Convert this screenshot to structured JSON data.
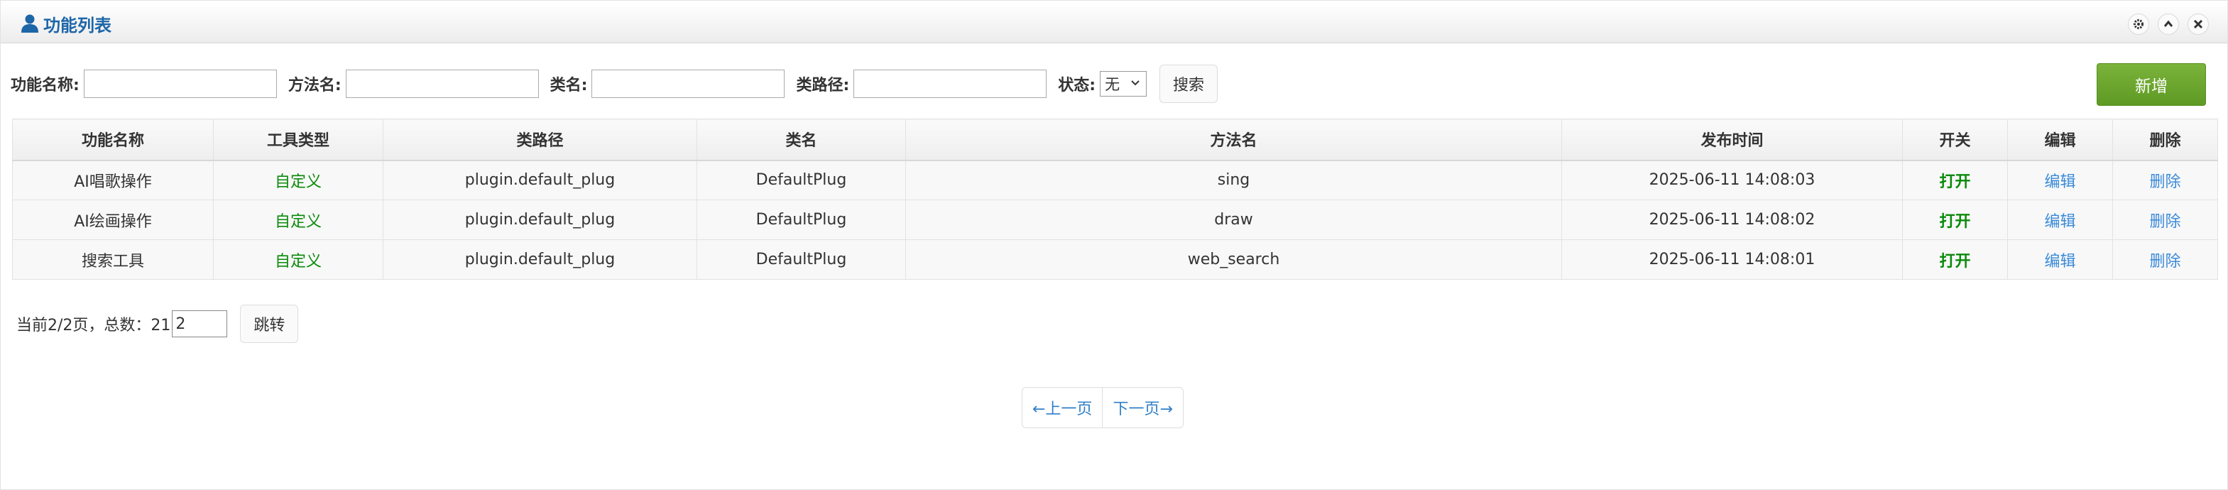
{
  "header": {
    "title": "功能列表",
    "icons": [
      "user-icon",
      "gear-icon",
      "chevron-up-icon",
      "close-icon"
    ]
  },
  "search": {
    "name_label": "功能名称:",
    "method_label": "方法名:",
    "class_label": "类名:",
    "path_label": "类路径:",
    "status_label": "状态:",
    "status_value": "无",
    "search_button": "搜索",
    "add_button": "新增"
  },
  "table": {
    "headers": [
      "功能名称",
      "工具类型",
      "类路径",
      "类名",
      "方法名",
      "发布时间",
      "开关",
      "编辑",
      "删除"
    ],
    "rows": [
      {
        "name": "AI唱歌操作",
        "type": "自定义",
        "path": "plugin.default_plug",
        "class": "DefaultPlug",
        "method": "sing",
        "time": "2025-06-11 14:08:03",
        "switch": "打开",
        "edit": "编辑",
        "delete": "删除"
      },
      {
        "name": "AI绘画操作",
        "type": "自定义",
        "path": "plugin.default_plug",
        "class": "DefaultPlug",
        "method": "draw",
        "time": "2025-06-11 14:08:02",
        "switch": "打开",
        "edit": "编辑",
        "delete": "删除"
      },
      {
        "name": "搜索工具",
        "type": "自定义",
        "path": "plugin.default_plug",
        "class": "DefaultPlug",
        "method": "web_search",
        "time": "2025-06-11 14:08:01",
        "switch": "打开",
        "edit": "编辑",
        "delete": "删除"
      }
    ]
  },
  "pagination": {
    "info": "当前2/2页，总数：21",
    "page_value": "2",
    "jump_button": "跳转",
    "prev": "←上一页",
    "next": "下一页→"
  },
  "colors": {
    "title_blue": "#1d66a8",
    "green_text": "#0a8a0a",
    "link_blue": "#3a8ad8",
    "add_green": "#6aa52c"
  }
}
